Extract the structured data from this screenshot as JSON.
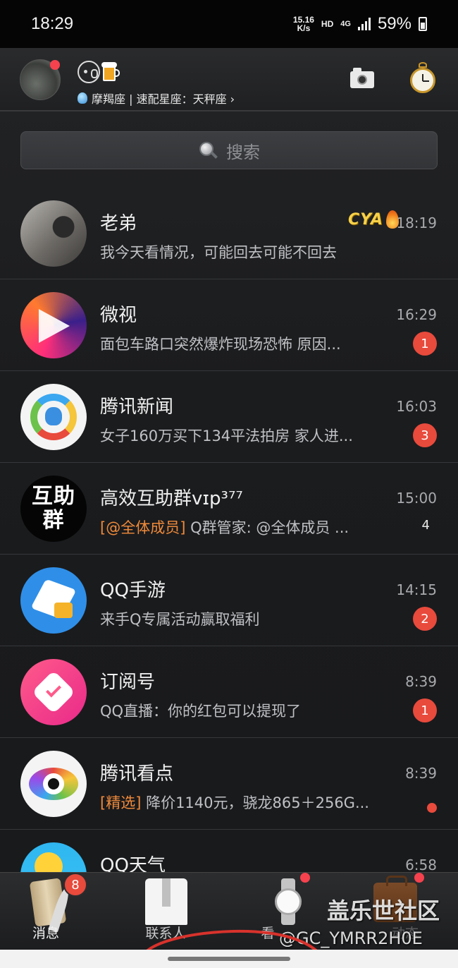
{
  "status_bar": {
    "time": "18:29",
    "net_speed_value": "15.16",
    "net_speed_unit": "K/s",
    "hd": "HD",
    "network": "4G",
    "battery": "59%"
  },
  "header": {
    "zodiac": "摩羯座 | 速配星座：天秤座 ›",
    "has_notification_dot": true
  },
  "search": {
    "placeholder": "搜索"
  },
  "conversations": [
    {
      "name": "老弟",
      "preview": "我今天看情况，可能回去可能不回去",
      "time": "18:19",
      "tag": "CYA"
    },
    {
      "name": "微视",
      "preview": "面包车路口突然爆炸现场恐怖 原因...",
      "time": "16:29",
      "badge": "1"
    },
    {
      "name": "腾讯新闻",
      "preview": "女子160万买下134平法拍房 家人进...",
      "time": "16:03",
      "badge": "3"
    },
    {
      "name": "高效互助群vɪp³⁷⁷",
      "preview_highlight": "[@全体成员]",
      "preview": " Q群管家: @全体成员 ...",
      "time": "15:00",
      "count": "4",
      "avatar_line1": "互助",
      "avatar_line2": "群"
    },
    {
      "name": "QQ手游",
      "preview": "来手Q专属活动赢取福利",
      "time": "14:15",
      "badge": "2"
    },
    {
      "name": "订阅号",
      "preview": "QQ直播：你的红包可以提现了",
      "time": "8:39",
      "badge": "1"
    },
    {
      "name": "腾讯看点",
      "preview_highlight": "[精选]",
      "preview": " 降价1140元，骁龙865＋256G...",
      "time": "8:39"
    },
    {
      "name": "QQ天气",
      "time": "6:58"
    }
  ],
  "tabs": {
    "messages": {
      "label": "消息",
      "badge": "8"
    },
    "contacts": {
      "label": "联系人"
    },
    "watch": {
      "label": "看"
    },
    "dynamic": {
      "label": "动态"
    }
  },
  "watermark": {
    "line1": "盖乐世社区",
    "line2": "@GC_YMRR2H0E"
  },
  "colors": {
    "badge": "#e84a3c",
    "highlight": "#f08a3a",
    "background": "#1b1c1e"
  }
}
